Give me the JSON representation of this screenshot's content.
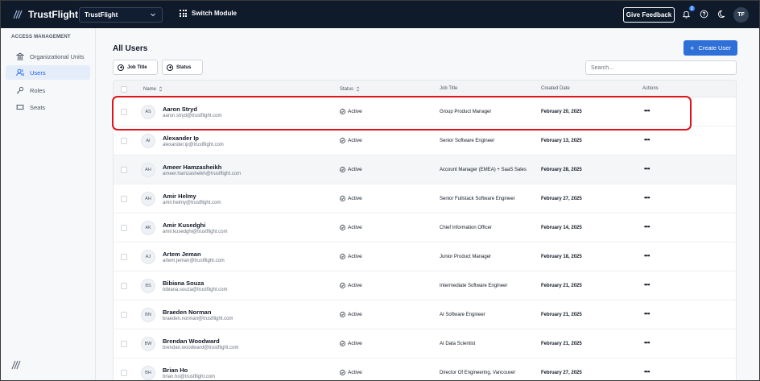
{
  "app": {
    "brand": "TrustFlight",
    "org_select": "TrustFlight",
    "switch_module": "Switch Module",
    "feedback": "Give Feedback",
    "notification_count": "2",
    "user_initials": "TF"
  },
  "sidebar": {
    "section": "ACCESS MANAGEMENT",
    "items": [
      {
        "label": "Organizational Units",
        "icon": "bank-icon"
      },
      {
        "label": "Users",
        "icon": "users-icon",
        "active": true
      },
      {
        "label": "Roles",
        "icon": "key-icon"
      },
      {
        "label": "Seats",
        "icon": "ticket-icon"
      }
    ]
  },
  "main": {
    "title": "All Users",
    "create_button": "Create User",
    "filters": [
      "Job Title",
      "Status"
    ],
    "search_placeholder": "Search...",
    "columns": [
      "Name",
      "Status",
      "Job Title",
      "Created Date",
      "Actions"
    ],
    "users": [
      {
        "initials": "AS",
        "name": "Aaron Stryd",
        "email": "aaron.stryd@trustflight.com",
        "status": "Active",
        "job": "Group Product Manager",
        "date": "February 20, 2025"
      },
      {
        "initials": "AI",
        "name": "Alexander Ip",
        "email": "alexander.ip@trustflight.com",
        "status": "Active",
        "job": "Senior Software Engineer",
        "date": "February 13, 2025"
      },
      {
        "initials": "AH",
        "name": "Ameer Hamzasheikh",
        "email": "ameer.hamzasheikh@trustflight.com",
        "status": "Active",
        "job": "Account Manager (EMEA) + SaaS Sales",
        "date": "February 28, 2025"
      },
      {
        "initials": "AH",
        "name": "Amir Helmy",
        "email": "amir.helmy@trustflight.com",
        "status": "Active",
        "job": "Senior Fullstack Software Engineer",
        "date": "February 27, 2025"
      },
      {
        "initials": "AK",
        "name": "Amir Kusedghi",
        "email": "amir.kusedghi@trustflight.com",
        "status": "Active",
        "job": "Chief Information Officer",
        "date": "February 14, 2025"
      },
      {
        "initials": "AJ",
        "name": "Artem Jeman",
        "email": "artem.jeman@trustflight.com",
        "status": "Active",
        "job": "Junior Product Manager",
        "date": "February 18, 2025"
      },
      {
        "initials": "BS",
        "name": "Bibiana Souza",
        "email": "bibiana.souza@trustflight.com",
        "status": "Active",
        "job": "Intermediate Software Engineer",
        "date": "February 21, 2025"
      },
      {
        "initials": "BN",
        "name": "Braeden Norman",
        "email": "braeden.norman@trustflight.com",
        "status": "Active",
        "job": "AI Software Engineer",
        "date": "February 21, 2025"
      },
      {
        "initials": "BW",
        "name": "Brendan Woodward",
        "email": "brendan.woodward@trustflight.com",
        "status": "Active",
        "job": "AI Data Scientist",
        "date": "February 21, 2025"
      },
      {
        "initials": "BH",
        "name": "Brian Ho",
        "email": "brian.ho@trustflight.com",
        "status": "Active",
        "job": "Director Of Engineering, Vancouver",
        "date": "February 27, 2025"
      }
    ],
    "action_glyph": "•••"
  },
  "colors": {
    "topbar": "#0f1a2b",
    "accent": "#2f6fd8",
    "highlight": "#e0131a"
  }
}
